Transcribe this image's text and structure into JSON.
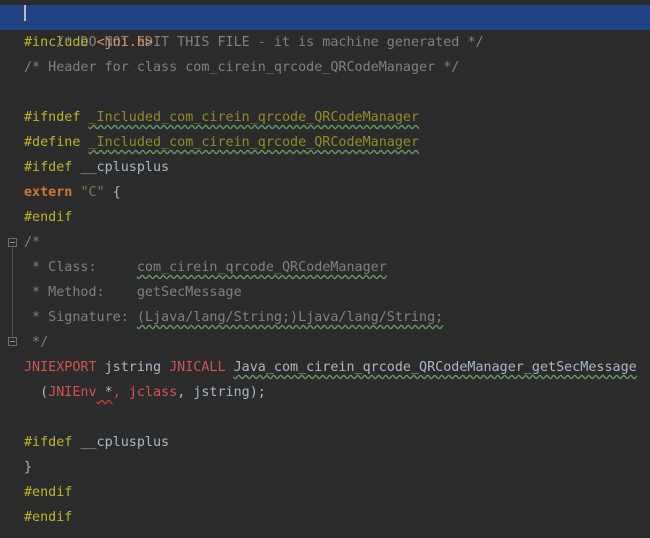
{
  "editor": {
    "lines": [
      "/* DO NOT EDIT THIS FILE - it is machine generated */",
      "#include <jni.h>",
      "/* Header for class com_cirein_qrcode_QRCodeManager */",
      "",
      "#ifndef _Included_com_cirein_qrcode_QRCodeManager",
      "#define _Included_com_cirein_qrcode_QRCodeManager",
      "#ifdef __cplusplus",
      "extern \"C\" {",
      "#endif",
      "/*",
      " * Class:     com_cirein_qrcode_QRCodeManager",
      " * Method:    getSecMessage",
      " * Signature: (Ljava/lang/String;)Ljava/lang/String;",
      " */",
      "JNIEXPORT jstring JNICALL Java_com_cirein_qrcode_QRCodeManager_getSecMessage",
      "  (JNIEnv *, jclass, jstring);",
      "",
      "#ifdef __cplusplus",
      "}",
      "#endif",
      "#endif"
    ],
    "tokens": {
      "l1_comment": "/* DO NOT EDIT THIS FILE - it is machine generated */",
      "l2_directive": "#include",
      "l2_header": "<jni.h>",
      "l3_comment": "/* Header for class com_cirein_qrcode_QRCodeManager */",
      "l5_directive": "#ifndef",
      "l5_macro": "_Included_com_cirein_qrcode_QRCodeManager",
      "l6_directive": "#define",
      "l6_macro": "_Included_com_cirein_qrcode_QRCodeManager",
      "l7_directive": "#ifdef",
      "l7_macro": "__cplusplus",
      "l8_keyword": "extern",
      "l8_string": "\"C\"",
      "l8_brace": "{",
      "l9_directive": "#endif",
      "l10_comment": "/*",
      "l11_prefix": " * Class:     ",
      "l11_value": "com_cirein_qrcode_QRCodeManager",
      "l12_prefix": " * Method:    ",
      "l12_value": "getSecMessage",
      "l13_prefix": " * Signature: ",
      "l13_value": "(Ljava/lang/String;)Ljava/lang/String;",
      "l14_comment": " */",
      "l15_export": "JNIEXPORT",
      "l15_type": "jstring",
      "l15_call": "JNICALL",
      "l15_func": "Java_com_cirein_qrcode_QRCodeManager_getSecMessage",
      "l16_open": "  (",
      "l16_env": "JNIEnv",
      "l16_ptr": " *",
      "l16_comma1": ",",
      "l16_jclass": "jclass",
      "l16_rest": ", jstring);",
      "l18_directive": "#ifdef",
      "l18_macro": "__cplusplus",
      "l19_brace": "}",
      "l20_directive": "#endif",
      "l21_directive": "#endif"
    }
  },
  "theme": {
    "background": "#2b2b2b",
    "selection": "#214283",
    "comment": "#808080",
    "directive": "#bbb529",
    "keyword": "#cc7832",
    "error": "#d25252"
  }
}
